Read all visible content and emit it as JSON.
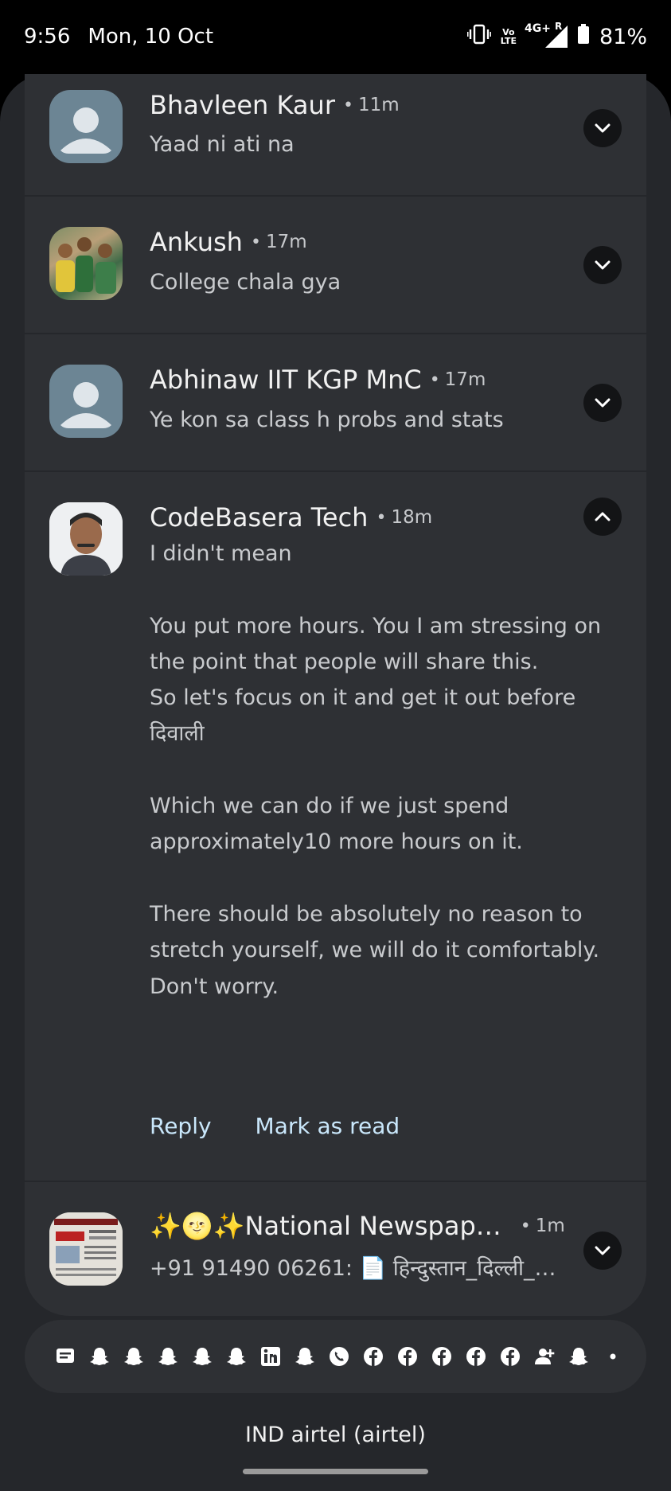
{
  "status_bar": {
    "time": "9:56",
    "date": "Mon, 10 Oct",
    "volte_top": "Vo",
    "volte_bottom": "LTE",
    "network": "4G+",
    "roaming": "R",
    "battery": "81%",
    "battery_level": 0.81,
    "icons": [
      "vibrate-icon",
      "volte-icon",
      "signal-icon",
      "battery-icon"
    ]
  },
  "notifications": [
    {
      "sender": "Bhavleen Kaur",
      "time": "11m",
      "message": "Yaad ni ati na",
      "avatar": "default-avatar",
      "expanded": false
    },
    {
      "sender": "Ankush",
      "time": "17m",
      "message": "College chala gya",
      "avatar": "group-photo",
      "expanded": false
    },
    {
      "sender": "Abhinaw IIT KGP MnC",
      "time": "17m",
      "message": "Ye kon sa class h probs and stats",
      "avatar": "default-avatar",
      "expanded": false
    },
    {
      "sender": "CodeBasera Tech",
      "time": "18m",
      "avatar": "portrait-photo",
      "expanded": true,
      "message": "I didn't mean\n\nYou put more hours. You I am stressing on\nthe point that people will share this.\nSo let's focus on it and get it out before दिवाली\n\nWhich we can do if we just spend\napproximately10 more hours on it.\n\nThere should be absolutely no reason to\nstretch yourself, we will do it comfortably.\nDon't worry.",
      "actions": [
        "Reply",
        "Mark as read"
      ]
    },
    {
      "sender": "✨🌝✨National Newspap…",
      "time": "1m",
      "message": "+91 91490 06261: 📄 हिन्दुस्तान_दिल्ली_…",
      "avatar": "newspaper-thumbnail",
      "expanded": false
    }
  ],
  "tray_icons": [
    "messages-icon",
    "snapchat-icon",
    "snapchat-icon",
    "snapchat-icon",
    "snapchat-icon",
    "snapchat-icon",
    "linkedin-icon",
    "snapchat-icon",
    "whatsapp-icon",
    "facebook-icon",
    "facebook-icon",
    "facebook-icon",
    "facebook-icon",
    "facebook-icon",
    "add-contact-icon",
    "snapchat-icon",
    "more-dot-icon"
  ],
  "carrier": "IND airtel (airtel)"
}
